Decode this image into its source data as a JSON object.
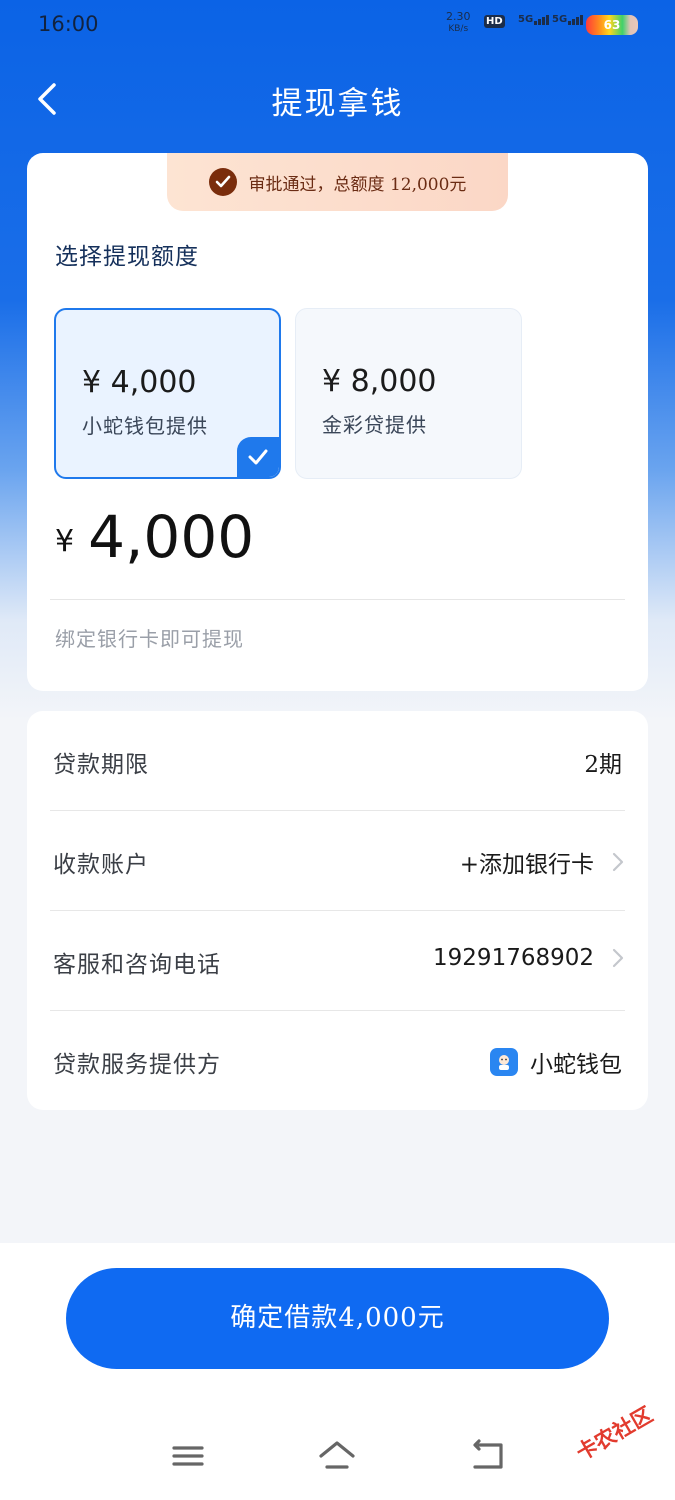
{
  "status_bar": {
    "time": "16:00",
    "net_speed_value": "2.30",
    "net_speed_unit": "KB/s",
    "hd_label": "HD",
    "sim1_label": "5G",
    "sim2_label": "5G",
    "battery": "63"
  },
  "header": {
    "title": "提现拿钱"
  },
  "approval": {
    "text": "审批通过，总额度 12,000元"
  },
  "select_label": "选择提现额度",
  "options": [
    {
      "amount": "¥ 4,000",
      "provider": "小蛇钱包提供",
      "selected": true
    },
    {
      "amount": "¥ 8,000",
      "provider": "金彩贷提供",
      "selected": false
    }
  ],
  "selected_amount": {
    "currency": "¥",
    "value": "4,000"
  },
  "bind_hint": "绑定银行卡即可提现",
  "details": [
    {
      "label": "贷款期限",
      "value": "2期",
      "arrow": false
    },
    {
      "label": "收款账户",
      "value": "+添加银行卡",
      "arrow": true
    },
    {
      "label": "客服和咨询电话",
      "value": "19291768902",
      "arrow": true
    },
    {
      "label": "贷款服务提供方",
      "value": "小蛇钱包",
      "arrow": false,
      "icon": "wallet-app-icon"
    }
  ],
  "confirm_button": "确定借款4,000元",
  "watermark": "卡农社区",
  "colors": {
    "primary": "#0f6af2",
    "header_blue": "#0b63e6",
    "approval_bg": "#fde4d3",
    "approval_text": "#6b2c14"
  }
}
